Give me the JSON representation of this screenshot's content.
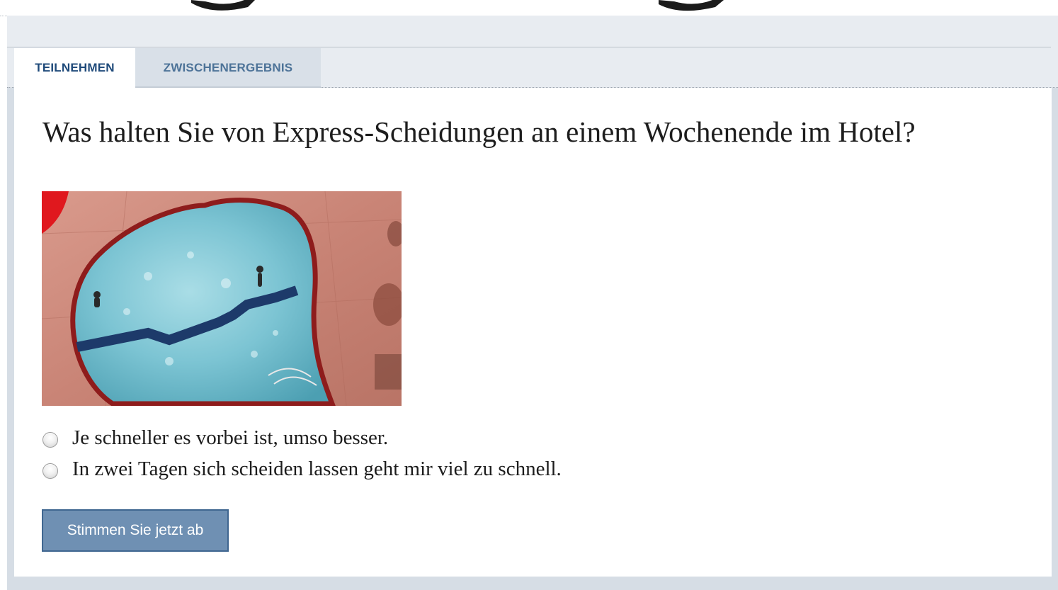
{
  "header": {
    "clipped_title": "…g…g"
  },
  "tabs": [
    {
      "label": "TEILNEHMEN",
      "active": true
    },
    {
      "label": "ZWISCHENERGEBNIS",
      "active": false
    }
  ],
  "poll": {
    "question": "Was halten Sie von Express-Scheidungen an einem Wochenende im Hotel?",
    "image": {
      "subject": "heart-shaped-pool-aerial"
    },
    "options": [
      {
        "label": "Je schneller es vorbei ist, umso besser.",
        "selected": false
      },
      {
        "label": "In zwei Tagen sich scheiden lassen geht mir viel zu schnell.",
        "selected": false
      }
    ],
    "submit_label": "Stimmen Sie jetzt ab"
  },
  "colors": {
    "tab_active_text": "#1f4a7a",
    "tab_inactive_text": "#4d7398",
    "button_bg": "#6f90b3",
    "button_border": "#3f6690",
    "frame_bg": "#d6dde5"
  }
}
